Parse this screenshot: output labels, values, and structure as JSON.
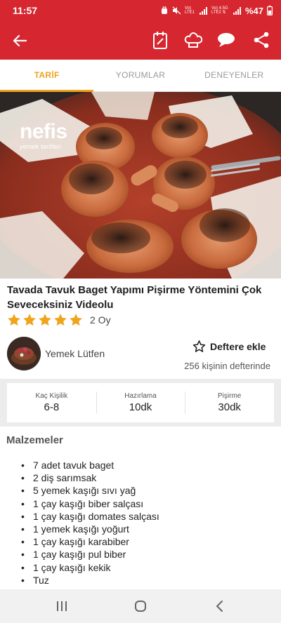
{
  "status_bar": {
    "time": "11:57",
    "battery": "%47",
    "icons": [
      "alarm-icon",
      "mute-icon",
      "signal-lte1-icon",
      "signal-lte2-icon",
      "battery-icon"
    ],
    "lte1": "Vo) LTE1",
    "lte2": "Vo) 4.5G LTE2"
  },
  "app_bar": {
    "icons": [
      "back-arrow-icon",
      "notepad-icon",
      "chef-hat-icon",
      "comment-icon",
      "share-icon"
    ]
  },
  "tabs": [
    {
      "label": "TARİF",
      "active": true
    },
    {
      "label": "YORUMLAR",
      "active": false
    },
    {
      "label": "DENEYENLER",
      "active": false
    }
  ],
  "hero": {
    "logo_text": "nefis",
    "logo_sub": "yemek tarifleri"
  },
  "recipe": {
    "title": "Tavada Tavuk Baget Yapımı Pişirme Yöntemini Çok Seveceksiniz Videolu",
    "rating_stars": 5,
    "rating_time": "2 Oy",
    "author": "Yemek Lütfen",
    "save_label": "Deftere ekle",
    "save_count": "256 kişinin defterinde"
  },
  "info": [
    {
      "label": "Kaç Kişilik",
      "value": "6-8"
    },
    {
      "label": "Hazırlama",
      "value": "10dk"
    },
    {
      "label": "Pişirme",
      "value": "30dk"
    }
  ],
  "ingredients": {
    "title": "Malzemeler",
    "items": [
      "7 adet tavuk baget",
      "2 diş sarımsak",
      "5 yemek kaşığı sıvı yağ",
      "1 çay kaşığı biber salçası",
      "1 çay kaşığı domates salçası",
      "1 yemek kaşığı yoğurt",
      "1 çay kaşığı karabiber",
      "1 çay kaşığı pul biber",
      "1 çay kaşığı kekik",
      "Tuz"
    ]
  },
  "colors": {
    "brand_red": "#d6262f",
    "tab_active": "#f0a31c",
    "star": "#f0a31c"
  }
}
